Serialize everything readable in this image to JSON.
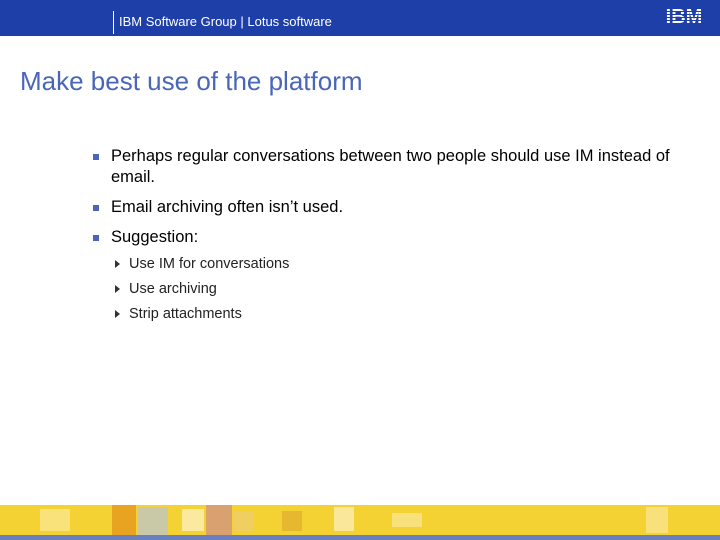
{
  "header": {
    "group_text": "IBM Software Group | Lotus software",
    "logo_text": "IBM"
  },
  "slide": {
    "title": "Make best use of the platform",
    "bullets": [
      {
        "text": "Perhaps regular conversations between two people should use IM instead of email."
      },
      {
        "text": "Email archiving often isn’t used."
      },
      {
        "text": "Suggestion:"
      }
    ],
    "sub_bullets": [
      {
        "text": "Use IM for conversations"
      },
      {
        "text": "Use archiving"
      },
      {
        "text": "Strip attachments"
      }
    ]
  },
  "colors": {
    "header_bg": "#1f3fa8",
    "title": "#4a66b8",
    "footer": "#f5d233"
  }
}
